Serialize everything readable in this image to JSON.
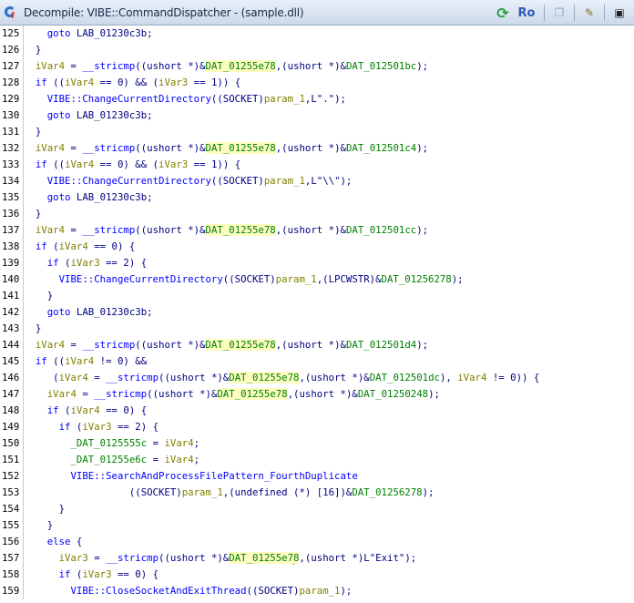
{
  "window": {
    "title": "Decompile: VIBE::CommandDispatcher -  (sample.dll)",
    "tools": {
      "refresh": "⟳",
      "ro": "Ro",
      "vars": "··≈",
      "copy": "❐",
      "edit": "✎",
      "snapshot": "▣"
    }
  },
  "lines": [
    {
      "n": "125",
      "s": [
        [
          "    ",
          "p"
        ],
        [
          "goto",
          "k"
        ],
        [
          " LAB_01230c3b;",
          "p"
        ]
      ]
    },
    {
      "n": "126",
      "s": [
        [
          "  }",
          "p"
        ]
      ]
    },
    {
      "n": "127",
      "s": [
        [
          "  ",
          "p"
        ],
        [
          "iVar4",
          "v"
        ],
        [
          " = ",
          "p"
        ],
        [
          "__stricmp",
          "fn"
        ],
        [
          "((",
          "p"
        ],
        [
          "ushort",
          "t"
        ],
        [
          " *)&",
          "p"
        ],
        [
          "DAT_01255e78",
          "g"
        ],
        [
          ",(",
          "p"
        ],
        [
          "ushort",
          "t"
        ],
        [
          " *)&",
          "p"
        ],
        [
          "DAT_012501bc",
          "g2"
        ],
        [
          ");",
          "p"
        ]
      ]
    },
    {
      "n": "128",
      "s": [
        [
          "  ",
          "p"
        ],
        [
          "if",
          "k"
        ],
        [
          " ((",
          "p"
        ],
        [
          "iVar4",
          "v"
        ],
        [
          " == 0) && (",
          "p"
        ],
        [
          "iVar3",
          "v"
        ],
        [
          " == 1)) {",
          "p"
        ]
      ]
    },
    {
      "n": "129",
      "s": [
        [
          "    ",
          "p"
        ],
        [
          "VIBE::ChangeCurrentDirectory",
          "fn"
        ],
        [
          "((SOCKET)",
          "p"
        ],
        [
          "param_1",
          "v"
        ],
        [
          ",L\".\");",
          "p"
        ]
      ]
    },
    {
      "n": "130",
      "s": [
        [
          "    ",
          "p"
        ],
        [
          "goto",
          "k"
        ],
        [
          " LAB_01230c3b;",
          "p"
        ]
      ]
    },
    {
      "n": "131",
      "s": [
        [
          "  }",
          "p"
        ]
      ]
    },
    {
      "n": "132",
      "s": [
        [
          "  ",
          "p"
        ],
        [
          "iVar4",
          "v"
        ],
        [
          " = ",
          "p"
        ],
        [
          "__stricmp",
          "fn"
        ],
        [
          "((",
          "p"
        ],
        [
          "ushort",
          "t"
        ],
        [
          " *)&",
          "p"
        ],
        [
          "DAT_01255e78",
          "g"
        ],
        [
          ",(",
          "p"
        ],
        [
          "ushort",
          "t"
        ],
        [
          " *)&",
          "p"
        ],
        [
          "DAT_012501c4",
          "g2"
        ],
        [
          ");",
          "p"
        ]
      ]
    },
    {
      "n": "133",
      "s": [
        [
          "  ",
          "p"
        ],
        [
          "if",
          "k"
        ],
        [
          " ((",
          "p"
        ],
        [
          "iVar4",
          "v"
        ],
        [
          " == 0) && (",
          "p"
        ],
        [
          "iVar3",
          "v"
        ],
        [
          " == 1)) {",
          "p"
        ]
      ]
    },
    {
      "n": "134",
      "s": [
        [
          "    ",
          "p"
        ],
        [
          "VIBE::ChangeCurrentDirectory",
          "fn"
        ],
        [
          "((SOCKET)",
          "p"
        ],
        [
          "param_1",
          "v"
        ],
        [
          ",L\"\\\\\");",
          "p"
        ]
      ]
    },
    {
      "n": "135",
      "s": [
        [
          "    ",
          "p"
        ],
        [
          "goto",
          "k"
        ],
        [
          " LAB_01230c3b;",
          "p"
        ]
      ]
    },
    {
      "n": "136",
      "s": [
        [
          "  }",
          "p"
        ]
      ]
    },
    {
      "n": "137",
      "s": [
        [
          "  ",
          "p"
        ],
        [
          "iVar4",
          "v"
        ],
        [
          " = ",
          "p"
        ],
        [
          "__stricmp",
          "fn"
        ],
        [
          "((",
          "p"
        ],
        [
          "ushort",
          "t"
        ],
        [
          " *)&",
          "p"
        ],
        [
          "DAT_01255e78",
          "g"
        ],
        [
          ",(",
          "p"
        ],
        [
          "ushort",
          "t"
        ],
        [
          " *)&",
          "p"
        ],
        [
          "DAT_012501cc",
          "g2"
        ],
        [
          ");",
          "p"
        ]
      ]
    },
    {
      "n": "138",
      "s": [
        [
          "  ",
          "p"
        ],
        [
          "if",
          "k"
        ],
        [
          " (",
          "p"
        ],
        [
          "iVar4",
          "v"
        ],
        [
          " == 0) {",
          "p"
        ]
      ]
    },
    {
      "n": "139",
      "s": [
        [
          "    ",
          "p"
        ],
        [
          "if",
          "k"
        ],
        [
          " (",
          "p"
        ],
        [
          "iVar3",
          "v"
        ],
        [
          " == 2) {",
          "p"
        ]
      ]
    },
    {
      "n": "140",
      "s": [
        [
          "      ",
          "p"
        ],
        [
          "VIBE::ChangeCurrentDirectory",
          "fn"
        ],
        [
          "((SOCKET)",
          "p"
        ],
        [
          "param_1",
          "v"
        ],
        [
          ",(LPCWSTR)&",
          "p"
        ],
        [
          "DAT_01256278",
          "g2"
        ],
        [
          ");",
          "p"
        ]
      ]
    },
    {
      "n": "141",
      "s": [
        [
          "    }",
          "p"
        ]
      ]
    },
    {
      "n": "142",
      "s": [
        [
          "    ",
          "p"
        ],
        [
          "goto",
          "k"
        ],
        [
          " LAB_01230c3b;",
          "p"
        ]
      ]
    },
    {
      "n": "143",
      "s": [
        [
          "  }",
          "p"
        ]
      ]
    },
    {
      "n": "144",
      "s": [
        [
          "  ",
          "p"
        ],
        [
          "iVar4",
          "v"
        ],
        [
          " = ",
          "p"
        ],
        [
          "__stricmp",
          "fn"
        ],
        [
          "((",
          "p"
        ],
        [
          "ushort",
          "t"
        ],
        [
          " *)&",
          "p"
        ],
        [
          "DAT_01255e78",
          "g"
        ],
        [
          ",(",
          "p"
        ],
        [
          "ushort",
          "t"
        ],
        [
          " *)&",
          "p"
        ],
        [
          "DAT_012501d4",
          "g2"
        ],
        [
          ");",
          "p"
        ]
      ]
    },
    {
      "n": "145",
      "s": [
        [
          "  ",
          "p"
        ],
        [
          "if",
          "k"
        ],
        [
          " ((",
          "p"
        ],
        [
          "iVar4",
          "v"
        ],
        [
          " != 0) &&",
          "p"
        ]
      ]
    },
    {
      "n": "146",
      "s": [
        [
          "     (",
          "p"
        ],
        [
          "iVar4",
          "v"
        ],
        [
          " = ",
          "p"
        ],
        [
          "__stricmp",
          "fn"
        ],
        [
          "((",
          "p"
        ],
        [
          "ushort",
          "t"
        ],
        [
          " *)&",
          "p"
        ],
        [
          "DAT_01255e78",
          "g"
        ],
        [
          ",(",
          "p"
        ],
        [
          "ushort",
          "t"
        ],
        [
          " *)&",
          "p"
        ],
        [
          "DAT_012501dc",
          "g2"
        ],
        [
          "), ",
          "p"
        ],
        [
          "iVar4",
          "v"
        ],
        [
          " != 0)) {",
          "p"
        ]
      ]
    },
    {
      "n": "147",
      "s": [
        [
          "    ",
          "p"
        ],
        [
          "iVar4",
          "v"
        ],
        [
          " = ",
          "p"
        ],
        [
          "__stricmp",
          "fn"
        ],
        [
          "((",
          "p"
        ],
        [
          "ushort",
          "t"
        ],
        [
          " *)&",
          "p"
        ],
        [
          "DAT_01255e78",
          "g"
        ],
        [
          ",(",
          "p"
        ],
        [
          "ushort",
          "t"
        ],
        [
          " *)&",
          "p"
        ],
        [
          "DAT_01250248",
          "g2"
        ],
        [
          ");",
          "p"
        ]
      ]
    },
    {
      "n": "148",
      "s": [
        [
          "    ",
          "p"
        ],
        [
          "if",
          "k"
        ],
        [
          " (",
          "p"
        ],
        [
          "iVar4",
          "v"
        ],
        [
          " == 0) {",
          "p"
        ]
      ]
    },
    {
      "n": "149",
      "s": [
        [
          "      ",
          "p"
        ],
        [
          "if",
          "k"
        ],
        [
          " (",
          "p"
        ],
        [
          "iVar3",
          "v"
        ],
        [
          " == 2) {",
          "p"
        ]
      ]
    },
    {
      "n": "150",
      "s": [
        [
          "        ",
          "p"
        ],
        [
          "_DAT_0125555c",
          "g2"
        ],
        [
          " = ",
          "p"
        ],
        [
          "iVar4",
          "v"
        ],
        [
          ";",
          "p"
        ]
      ]
    },
    {
      "n": "151",
      "s": [
        [
          "        ",
          "p"
        ],
        [
          "_DAT_01255e6c",
          "g2"
        ],
        [
          " = ",
          "p"
        ],
        [
          "iVar4",
          "v"
        ],
        [
          ";",
          "p"
        ]
      ]
    },
    {
      "n": "152",
      "s": [
        [
          "        ",
          "p"
        ],
        [
          "VIBE::SearchAndProcessFilePattern_FourthDuplicate",
          "fn"
        ]
      ]
    },
    {
      "n": "153",
      "s": [
        [
          "                  ((SOCKET)",
          "p"
        ],
        [
          "param_1",
          "v"
        ],
        [
          ",(",
          "p"
        ],
        [
          "undefined",
          "t"
        ],
        [
          " (*) [16])&",
          "p"
        ],
        [
          "DAT_01256278",
          "g2"
        ],
        [
          ");",
          "p"
        ]
      ]
    },
    {
      "n": "154",
      "s": [
        [
          "      }",
          "p"
        ]
      ]
    },
    {
      "n": "155",
      "s": [
        [
          "    }",
          "p"
        ]
      ]
    },
    {
      "n": "156",
      "s": [
        [
          "    ",
          "p"
        ],
        [
          "else",
          "k"
        ],
        [
          " {",
          "p"
        ]
      ]
    },
    {
      "n": "157",
      "s": [
        [
          "      ",
          "p"
        ],
        [
          "iVar3",
          "v"
        ],
        [
          " = ",
          "p"
        ],
        [
          "__stricmp",
          "fn"
        ],
        [
          "((",
          "p"
        ],
        [
          "ushort",
          "t"
        ],
        [
          " *)&",
          "p"
        ],
        [
          "DAT_01255e7",
          "g"
        ],
        [
          "|",
          "cursor"
        ],
        [
          "8",
          "g"
        ],
        [
          ",(",
          "p"
        ],
        [
          "ushort",
          "t"
        ],
        [
          " *)L\"Exit\");",
          "p"
        ]
      ]
    },
    {
      "n": "158",
      "s": [
        [
          "      ",
          "p"
        ],
        [
          "if",
          "k"
        ],
        [
          " (",
          "p"
        ],
        [
          "iVar3",
          "v"
        ],
        [
          " == 0) {",
          "p"
        ]
      ]
    },
    {
      "n": "159",
      "s": [
        [
          "        ",
          "p"
        ],
        [
          "VIBE::CloseSocketAndExitThread",
          "fn"
        ],
        [
          "((SOCKET)",
          "p"
        ],
        [
          "param_1",
          "v"
        ],
        [
          ");",
          "p"
        ]
      ]
    }
  ]
}
